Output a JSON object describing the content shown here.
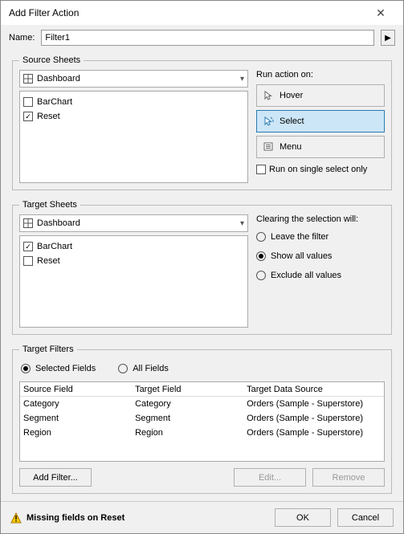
{
  "window_title": "Add Filter Action",
  "name_label": "Name:",
  "name_value": "Filter1",
  "source_sheets": {
    "legend": "Source Sheets",
    "dashboard": "Dashboard",
    "items": [
      {
        "label": "BarChart",
        "checked": false
      },
      {
        "label": "Reset",
        "checked": true
      }
    ],
    "run_label": "Run action on:",
    "hover": "Hover",
    "select": "Select",
    "menu": "Menu",
    "single_select": "Run on single select only"
  },
  "target_sheets": {
    "legend": "Target Sheets",
    "dashboard": "Dashboard",
    "items": [
      {
        "label": "BarChart",
        "checked": true
      },
      {
        "label": "Reset",
        "checked": false
      }
    ],
    "clearing_label": "Clearing the selection will:",
    "options": [
      {
        "label": "Leave the filter",
        "checked": false
      },
      {
        "label": "Show all values",
        "checked": true
      },
      {
        "label": "Exclude all values",
        "checked": false
      }
    ]
  },
  "target_filters": {
    "legend": "Target Filters",
    "selected_fields": "Selected Fields",
    "all_fields": "All Fields",
    "headers": {
      "c1": "Source Field",
      "c2": "Target Field",
      "c3": "Target Data Source"
    },
    "rows": [
      {
        "c1": "Category",
        "c2": "Category",
        "c3": "Orders (Sample - Superstore)"
      },
      {
        "c1": "Segment",
        "c2": "Segment",
        "c3": "Orders (Sample - Superstore)"
      },
      {
        "c1": "Region",
        "c2": "Region",
        "c3": "Orders (Sample - Superstore)"
      }
    ],
    "add_filter": "Add Filter...",
    "edit": "Edit...",
    "remove": "Remove"
  },
  "footer": {
    "status": "Missing fields on Reset",
    "ok": "OK",
    "cancel": "Cancel"
  }
}
